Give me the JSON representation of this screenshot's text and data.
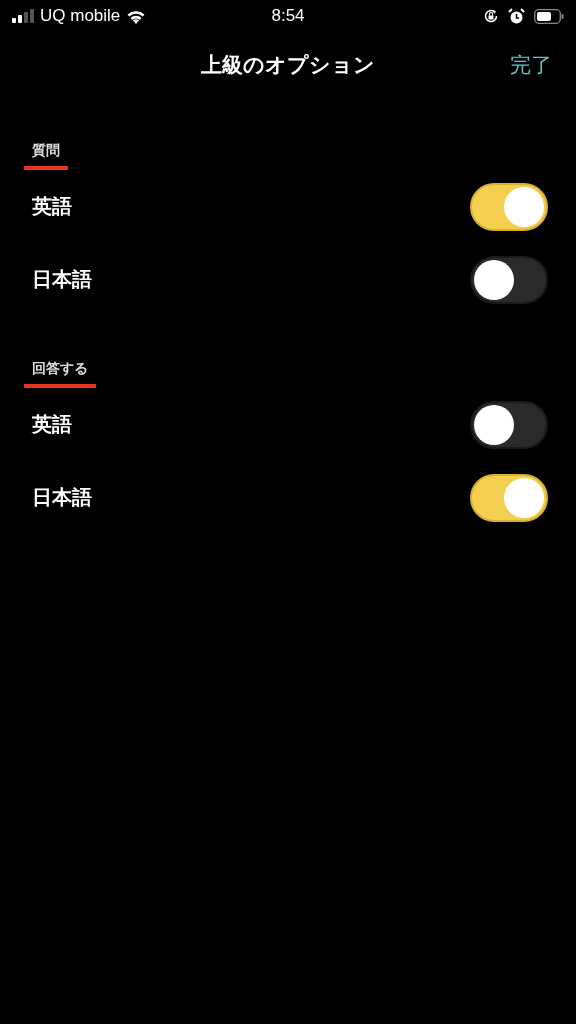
{
  "status_bar": {
    "carrier": "UQ mobile",
    "time": "8:54"
  },
  "nav": {
    "title": "上級のオプション",
    "done": "完了"
  },
  "sections": [
    {
      "header": "質問",
      "rows": [
        {
          "label": "英語",
          "on": true
        },
        {
          "label": "日本語",
          "on": false
        }
      ]
    },
    {
      "header": "回答する",
      "rows": [
        {
          "label": "英語",
          "on": false
        },
        {
          "label": "日本語",
          "on": true
        }
      ]
    }
  ]
}
